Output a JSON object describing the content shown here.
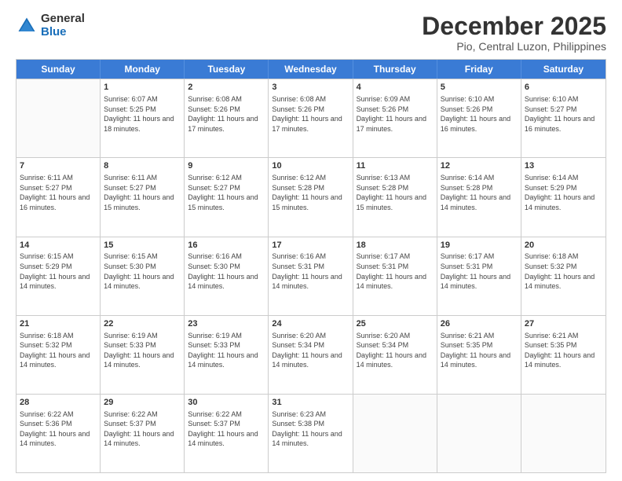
{
  "logo": {
    "general": "General",
    "blue": "Blue"
  },
  "title": "December 2025",
  "subtitle": "Pio, Central Luzon, Philippines",
  "header_days": [
    "Sunday",
    "Monday",
    "Tuesday",
    "Wednesday",
    "Thursday",
    "Friday",
    "Saturday"
  ],
  "rows": [
    [
      {
        "day": "",
        "empty": true
      },
      {
        "day": "1",
        "rise": "6:07 AM",
        "set": "5:25 PM",
        "daylight": "11 hours and 18 minutes."
      },
      {
        "day": "2",
        "rise": "6:08 AM",
        "set": "5:26 PM",
        "daylight": "11 hours and 17 minutes."
      },
      {
        "day": "3",
        "rise": "6:08 AM",
        "set": "5:26 PM",
        "daylight": "11 hours and 17 minutes."
      },
      {
        "day": "4",
        "rise": "6:09 AM",
        "set": "5:26 PM",
        "daylight": "11 hours and 17 minutes."
      },
      {
        "day": "5",
        "rise": "6:10 AM",
        "set": "5:26 PM",
        "daylight": "11 hours and 16 minutes."
      },
      {
        "day": "6",
        "rise": "6:10 AM",
        "set": "5:27 PM",
        "daylight": "11 hours and 16 minutes."
      }
    ],
    [
      {
        "day": "7",
        "rise": "6:11 AM",
        "set": "5:27 PM",
        "daylight": "11 hours and 16 minutes."
      },
      {
        "day": "8",
        "rise": "6:11 AM",
        "set": "5:27 PM",
        "daylight": "11 hours and 15 minutes."
      },
      {
        "day": "9",
        "rise": "6:12 AM",
        "set": "5:27 PM",
        "daylight": "11 hours and 15 minutes."
      },
      {
        "day": "10",
        "rise": "6:12 AM",
        "set": "5:28 PM",
        "daylight": "11 hours and 15 minutes."
      },
      {
        "day": "11",
        "rise": "6:13 AM",
        "set": "5:28 PM",
        "daylight": "11 hours and 15 minutes."
      },
      {
        "day": "12",
        "rise": "6:14 AM",
        "set": "5:28 PM",
        "daylight": "11 hours and 14 minutes."
      },
      {
        "day": "13",
        "rise": "6:14 AM",
        "set": "5:29 PM",
        "daylight": "11 hours and 14 minutes."
      }
    ],
    [
      {
        "day": "14",
        "rise": "6:15 AM",
        "set": "5:29 PM",
        "daylight": "11 hours and 14 minutes."
      },
      {
        "day": "15",
        "rise": "6:15 AM",
        "set": "5:30 PM",
        "daylight": "11 hours and 14 minutes."
      },
      {
        "day": "16",
        "rise": "6:16 AM",
        "set": "5:30 PM",
        "daylight": "11 hours and 14 minutes."
      },
      {
        "day": "17",
        "rise": "6:16 AM",
        "set": "5:31 PM",
        "daylight": "11 hours and 14 minutes."
      },
      {
        "day": "18",
        "rise": "6:17 AM",
        "set": "5:31 PM",
        "daylight": "11 hours and 14 minutes."
      },
      {
        "day": "19",
        "rise": "6:17 AM",
        "set": "5:31 PM",
        "daylight": "11 hours and 14 minutes."
      },
      {
        "day": "20",
        "rise": "6:18 AM",
        "set": "5:32 PM",
        "daylight": "11 hours and 14 minutes."
      }
    ],
    [
      {
        "day": "21",
        "rise": "6:18 AM",
        "set": "5:32 PM",
        "daylight": "11 hours and 14 minutes."
      },
      {
        "day": "22",
        "rise": "6:19 AM",
        "set": "5:33 PM",
        "daylight": "11 hours and 14 minutes."
      },
      {
        "day": "23",
        "rise": "6:19 AM",
        "set": "5:33 PM",
        "daylight": "11 hours and 14 minutes."
      },
      {
        "day": "24",
        "rise": "6:20 AM",
        "set": "5:34 PM",
        "daylight": "11 hours and 14 minutes."
      },
      {
        "day": "25",
        "rise": "6:20 AM",
        "set": "5:34 PM",
        "daylight": "11 hours and 14 minutes."
      },
      {
        "day": "26",
        "rise": "6:21 AM",
        "set": "5:35 PM",
        "daylight": "11 hours and 14 minutes."
      },
      {
        "day": "27",
        "rise": "6:21 AM",
        "set": "5:35 PM",
        "daylight": "11 hours and 14 minutes."
      }
    ],
    [
      {
        "day": "28",
        "rise": "6:22 AM",
        "set": "5:36 PM",
        "daylight": "11 hours and 14 minutes."
      },
      {
        "day": "29",
        "rise": "6:22 AM",
        "set": "5:37 PM",
        "daylight": "11 hours and 14 minutes."
      },
      {
        "day": "30",
        "rise": "6:22 AM",
        "set": "5:37 PM",
        "daylight": "11 hours and 14 minutes."
      },
      {
        "day": "31",
        "rise": "6:23 AM",
        "set": "5:38 PM",
        "daylight": "11 hours and 14 minutes."
      },
      {
        "day": "",
        "empty": true
      },
      {
        "day": "",
        "empty": true
      },
      {
        "day": "",
        "empty": true
      }
    ]
  ],
  "labels": {
    "sunrise": "Sunrise:",
    "sunset": "Sunset:",
    "daylight": "Daylight:"
  }
}
